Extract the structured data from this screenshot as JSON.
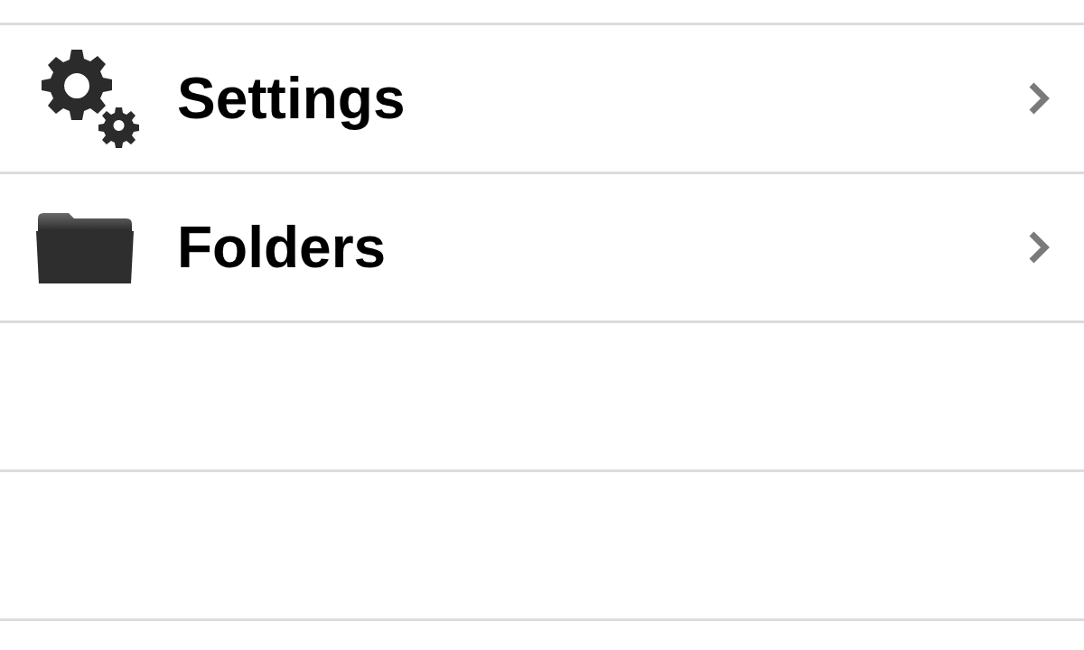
{
  "menu": {
    "items": [
      {
        "kind": "gears",
        "label": "Settings"
      },
      {
        "kind": "folder",
        "label": "Folders"
      }
    ]
  }
}
